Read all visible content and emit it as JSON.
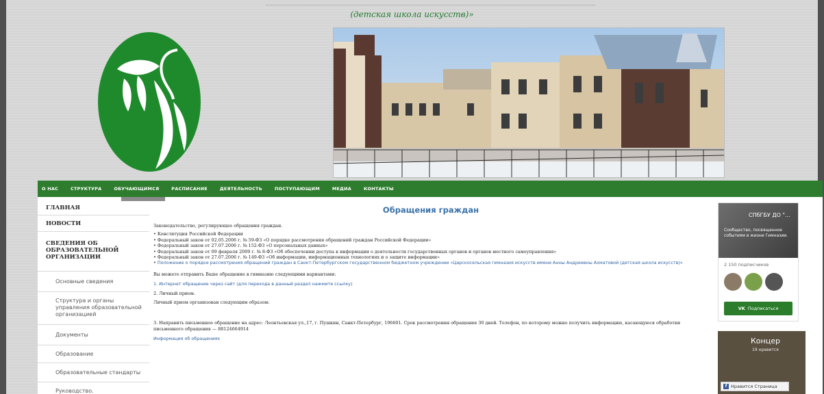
{
  "header": {
    "school_name": "(детская школа искусств)»"
  },
  "nav": {
    "items": [
      "О НАС",
      "СТРУКТУРА",
      "ОБУЧАЮЩИМСЯ",
      "РАСПИСАНИЕ",
      "ДЕЯТЕЛЬНОСТЬ",
      "ПОСТУПАЮЩИМ",
      "МЕДИА",
      "КОНТАКТЫ"
    ]
  },
  "sidebar": {
    "items": [
      {
        "label": "ГЛАВНАЯ",
        "level": "main"
      },
      {
        "label": "НОВОСТИ",
        "level": "main"
      },
      {
        "label": "СВЕДЕНИЯ ОБ ОБРАЗОВАТЕЛЬНОЙ ОРГАНИЗАЦИИ",
        "level": "main"
      },
      {
        "label": "Основные сведения",
        "level": "sub"
      },
      {
        "label": "Структура и органы управления образовательной организацией",
        "level": "sub"
      },
      {
        "label": "Документы",
        "level": "sub"
      },
      {
        "label": "Образование",
        "level": "sub"
      },
      {
        "label": "Образовательные стандарты",
        "level": "sub"
      },
      {
        "label": "Руководство. Педагогический состав",
        "level": "sub"
      }
    ]
  },
  "content": {
    "title": "Обращения граждан",
    "intro": "Законодательство, регулирующее обращения граждан.",
    "laws": [
      "Конституция Российской Федерации",
      "Федеральный закон от 02.05.2006 г. № 59-ФЗ «О порядке рассмотрения обращений граждан Российской Федерации»",
      "Федеральный закон от 27.07.2006 г. № 152-ФЗ «О персональных данных»",
      "Федеральный закон от 09 февраля 2009 г. № 8-ФЗ «Об обеспечении доступа к информации о деятельности государственных органов и органов местного самоуправления»",
      "Федеральный закон от 27.07.2006 г. № 149-ФЗ «Об информации, информационных технологиях и о защите информации»"
    ],
    "regulation_link": "Положение о порядке рассмотрения обращений граждан в Санкт-Петербургском государственном бюджетном учреждении «Царскосельская гимназия искусств имени Анны Андреевны Ахматовой (детская школа искусств)»",
    "options_intro": "Вы можете отправить Ваше обращение в гимназию следующими вариантами:",
    "option1": "1. Интернет обращение через сайт (для перехода в данный раздел нажмите ссылку)",
    "option2": "2. Личный прием.",
    "option2_desc": "Личный прием организован следующим образом:",
    "option3": "3. Направить письменное обращение на адрес: Леонтьевская ул.,17, г. Пушкин, Санкт-Петербург, 196601. Срок рассмотрения обращения 30 дней. Телефон, по которому можно получить информацию, касающуюся обработки письменного обращения — 88124664914",
    "info_link": "Информация об обращениях"
  },
  "vk": {
    "name": "СПбГБУ ДО \"...",
    "desc": "Сообщество, посвященное событиям в жизни Гимназии.",
    "subscribers": "2 150 подписчиков",
    "button": "Подписаться",
    "vk_logo": "VK"
  },
  "fb": {
    "title": "Концер",
    "likes": "19 нравится",
    "button": "Нравится Страница",
    "fb_logo": "f"
  },
  "colors": {
    "nav_green": "#2e7d2e",
    "title_blue": "#3a72a8",
    "logo_green": "#1f8a2c"
  }
}
